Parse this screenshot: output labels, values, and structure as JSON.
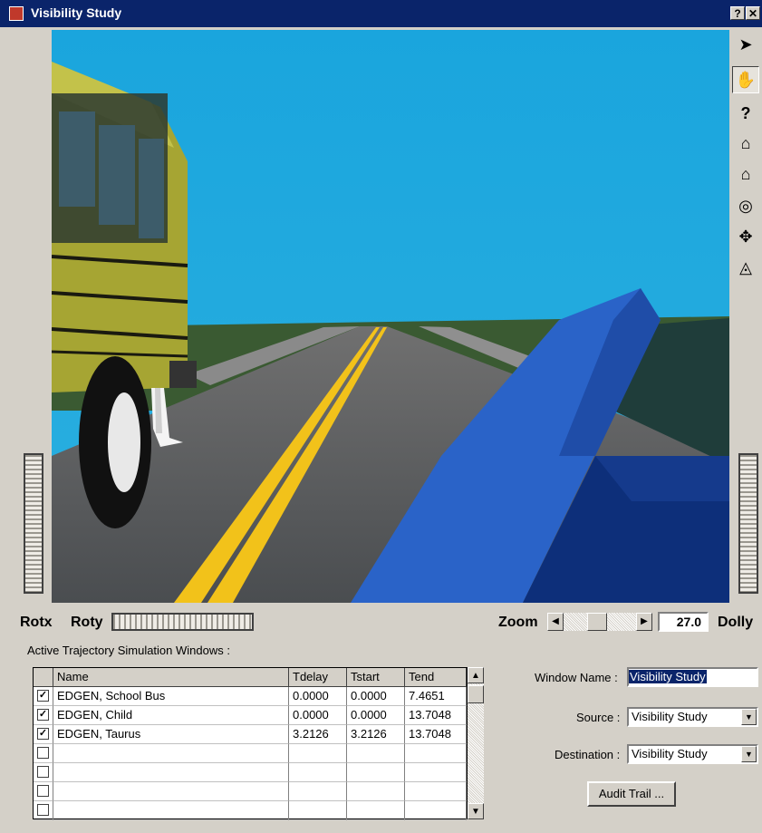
{
  "window": {
    "title": "Visibility Study",
    "help_button": "?",
    "close_button": "✕"
  },
  "toolbar": {
    "tools": [
      {
        "name": "select-arrow",
        "glyph": "➤"
      },
      {
        "name": "pan-hand",
        "glyph": "✋"
      },
      {
        "name": "help-query",
        "glyph": "?"
      },
      {
        "name": "home",
        "glyph": "⌂"
      },
      {
        "name": "set-home",
        "glyph": "⌂"
      },
      {
        "name": "view-all",
        "glyph": "◎"
      },
      {
        "name": "seek",
        "glyph": "✥"
      },
      {
        "name": "projection",
        "glyph": "◬"
      }
    ]
  },
  "controls": {
    "rotx_label": "Rotx",
    "roty_label": "Roty",
    "zoom_label": "Zoom",
    "zoom_value": "27.0",
    "dolly_label": "Dolly"
  },
  "trajectory": {
    "section_label": "Active Trajectory Simulation Windows :",
    "columns": [
      "Name",
      "Tdelay",
      "Tstart",
      "Tend"
    ],
    "rows": [
      {
        "checked": true,
        "name": "EDGEN, School Bus",
        "tdelay": "0.0000",
        "tstart": "0.0000",
        "tend": "7.4651"
      },
      {
        "checked": true,
        "name": "EDGEN, Child",
        "tdelay": "0.0000",
        "tstart": "0.0000",
        "tend": "13.7048"
      },
      {
        "checked": true,
        "name": "EDGEN, Taurus",
        "tdelay": "3.2126",
        "tstart": "3.2126",
        "tend": "13.7048"
      },
      {
        "checked": false,
        "name": "",
        "tdelay": "",
        "tstart": "",
        "tend": ""
      },
      {
        "checked": false,
        "name": "",
        "tdelay": "",
        "tstart": "",
        "tend": ""
      },
      {
        "checked": false,
        "name": "",
        "tdelay": "",
        "tstart": "",
        "tend": ""
      },
      {
        "checked": false,
        "name": "",
        "tdelay": "",
        "tstart": "",
        "tend": ""
      }
    ]
  },
  "form": {
    "window_name_label": "Window Name :",
    "window_name_value": "Visibility Study",
    "source_label": "Source :",
    "source_value": "Visibility Study",
    "destination_label": "Destination :",
    "destination_value": "Visibility Study",
    "audit_button": "Audit Trail ..."
  },
  "colors": {
    "titlebar": "#0a246a",
    "sky": "#1fa0d8",
    "road": "#55585b",
    "lane_line": "#f2c21a",
    "bus": "#a6a533",
    "car_hood": "#2a63c8"
  }
}
